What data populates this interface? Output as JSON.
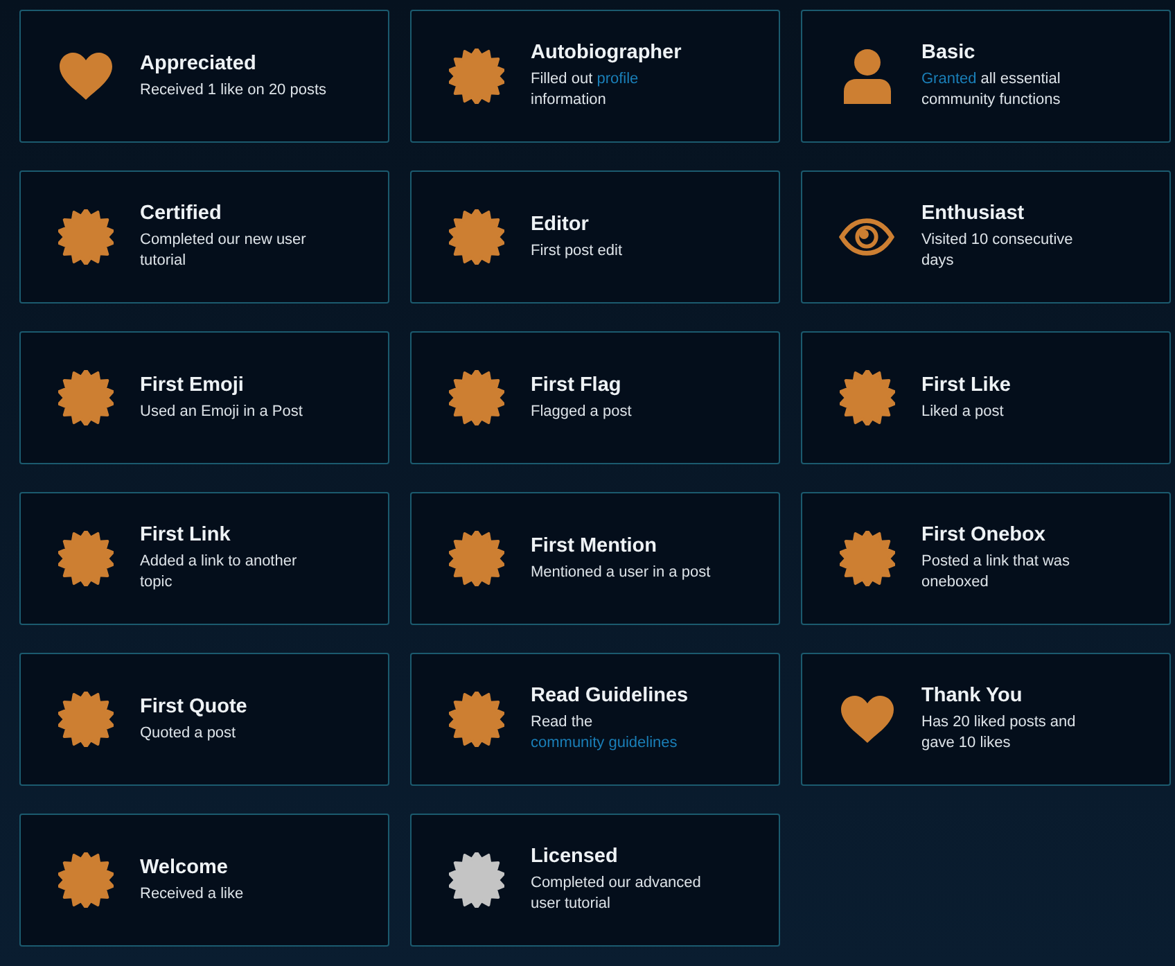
{
  "badges": [
    {
      "title": "Appreciated",
      "kind": "heart",
      "color": "#cd7f32",
      "description": [
        {
          "kind": "text",
          "text": "Received 1 like on 20 posts"
        }
      ]
    },
    {
      "title": "Autobiographer",
      "kind": "burst",
      "color": "#cd7f32",
      "description": [
        {
          "kind": "text",
          "text": "Filled out "
        },
        {
          "kind": "link",
          "text": "profile"
        },
        {
          "kind": "text",
          "text": " information"
        }
      ]
    },
    {
      "title": "Basic",
      "kind": "person",
      "color": "#cd7f32",
      "description": [
        {
          "kind": "link",
          "text": "Granted"
        },
        {
          "kind": "text",
          "text": " all essential community functions"
        }
      ]
    },
    {
      "title": "Certified",
      "kind": "burst",
      "color": "#cd7f32",
      "description": [
        {
          "kind": "text",
          "text": "Completed our new user tutorial"
        }
      ]
    },
    {
      "title": "Editor",
      "kind": "burst",
      "color": "#cd7f32",
      "description": [
        {
          "kind": "text",
          "text": "First post edit"
        }
      ]
    },
    {
      "title": "Enthusiast",
      "kind": "eye",
      "color": "#cd7f32",
      "description": [
        {
          "kind": "text",
          "text": "Visited 10 consecutive days"
        }
      ]
    },
    {
      "title": "First Emoji",
      "kind": "burst",
      "color": "#cd7f32",
      "description": [
        {
          "kind": "text",
          "text": "Used an Emoji in a Post"
        }
      ]
    },
    {
      "title": "First Flag",
      "kind": "burst",
      "color": "#cd7f32",
      "description": [
        {
          "kind": "text",
          "text": "Flagged a post"
        }
      ]
    },
    {
      "title": "First Like",
      "kind": "burst",
      "color": "#cd7f32",
      "description": [
        {
          "kind": "text",
          "text": "Liked a post"
        }
      ]
    },
    {
      "title": "First Link",
      "kind": "burst",
      "color": "#cd7f32",
      "description": [
        {
          "kind": "text",
          "text": "Added a link to another topic"
        }
      ]
    },
    {
      "title": "First Mention",
      "kind": "burst",
      "color": "#cd7f32",
      "description": [
        {
          "kind": "text",
          "text": "Mentioned a user in a post"
        }
      ]
    },
    {
      "title": "First Onebox",
      "kind": "burst",
      "color": "#cd7f32",
      "description": [
        {
          "kind": "text",
          "text": "Posted a link that was oneboxed"
        }
      ]
    },
    {
      "title": "First Quote",
      "kind": "burst",
      "color": "#cd7f32",
      "description": [
        {
          "kind": "text",
          "text": "Quoted a post"
        }
      ]
    },
    {
      "title": "Read Guidelines",
      "kind": "burst",
      "color": "#cd7f32",
      "description": [
        {
          "kind": "text",
          "text": "Read the "
        },
        {
          "kind": "link",
          "text": "community guidelines"
        }
      ]
    },
    {
      "title": "Thank You",
      "kind": "heart",
      "color": "#cd7f32",
      "description": [
        {
          "kind": "text",
          "text": "Has 20 liked posts and gave 10 likes"
        }
      ]
    },
    {
      "title": "Welcome",
      "kind": "burst",
      "color": "#cd7f32",
      "description": [
        {
          "kind": "text",
          "text": "Received a like"
        }
      ]
    },
    {
      "title": "Licensed",
      "kind": "burst",
      "color": "#c4c4c4",
      "description": [
        {
          "kind": "text",
          "text": "Completed our advanced user tutorial"
        }
      ]
    }
  ]
}
